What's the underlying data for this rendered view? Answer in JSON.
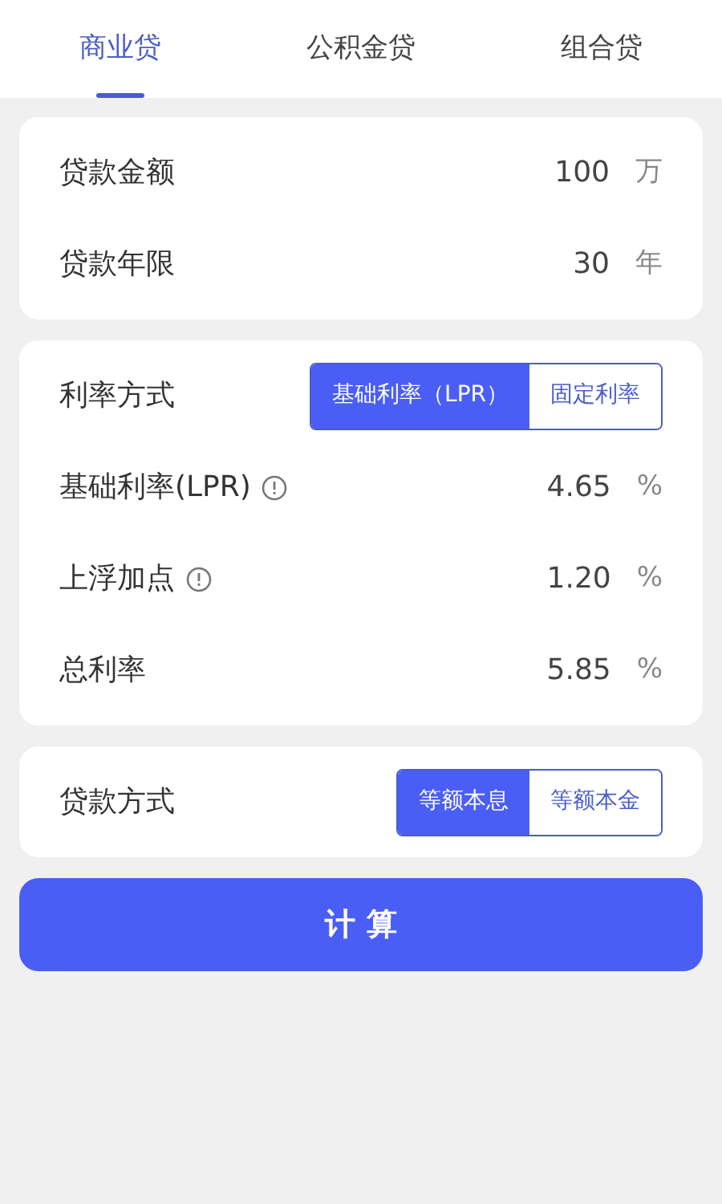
{
  "tabs": [
    {
      "label": "商业贷",
      "selected": true
    },
    {
      "label": "公积金贷",
      "selected": false
    },
    {
      "label": "组合贷",
      "selected": false
    }
  ],
  "cards": [
    {
      "rows": [
        {
          "kind": "field",
          "label": "贷款金额",
          "value": "100",
          "unit": "万"
        },
        {
          "kind": "field",
          "label": "贷款年限",
          "value": "30",
          "unit": "年"
        }
      ]
    },
    {
      "rows": [
        {
          "kind": "choice",
          "label": "利率方式",
          "options": [
            {
              "label": "基础利率（LPR）",
              "selected": true
            },
            {
              "label": "固定利率",
              "selected": false
            }
          ]
        },
        {
          "kind": "field",
          "label": "基础利率(LPR)",
          "info": true,
          "value": "4.65",
          "unit": "%"
        },
        {
          "kind": "field",
          "label": "上浮加点",
          "info": true,
          "value": "1.20",
          "unit": "%"
        },
        {
          "kind": "field",
          "label": "总利率",
          "value": "5.85",
          "unit": "%"
        }
      ]
    },
    {
      "rows": [
        {
          "kind": "choice",
          "label": "贷款方式",
          "options": [
            {
              "label": "等额本息",
              "selected": true
            },
            {
              "label": "等额本金",
              "selected": false
            }
          ]
        }
      ]
    }
  ],
  "calculate_button": "计 算"
}
